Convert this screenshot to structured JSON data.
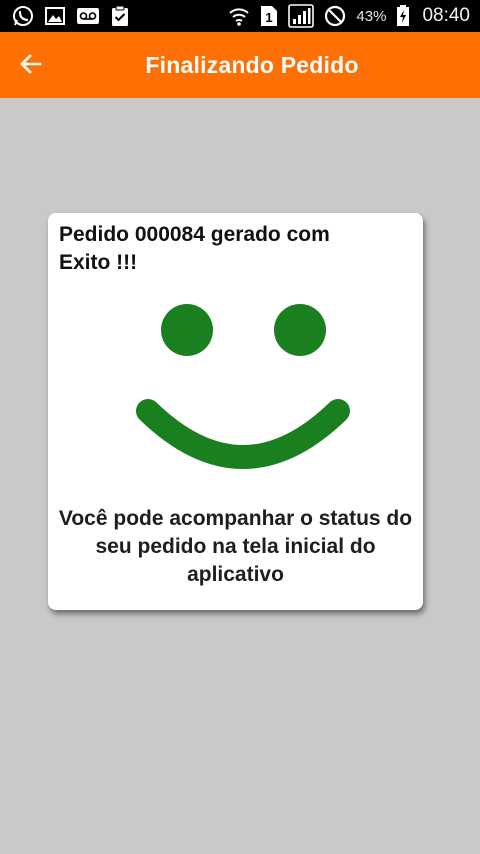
{
  "status_bar": {
    "battery_percent": "43%",
    "time": "08:40",
    "left_icons": [
      "whatsapp-icon",
      "image-icon",
      "voicemail-icon",
      "clipboard-check-icon"
    ],
    "right_icons": [
      "wifi-icon",
      "sim-1-icon",
      "signal-icon",
      "do-not-disturb-icon",
      "battery-charging-icon"
    ]
  },
  "app_bar": {
    "title": "Finalizando Pedido",
    "back_icon": "arrow-left-icon",
    "background_color": "#fe6f04"
  },
  "card": {
    "title": "Pedido 000084 gerado com Exito !!!",
    "message": "Você pode acompanhar o status do seu pedido na tela inicial do aplicativo",
    "smiley_color": "#1a7f1f",
    "image": "smiley-face"
  },
  "colors": {
    "page_background": "#c9c9c9",
    "card_background": "#ffffff"
  }
}
